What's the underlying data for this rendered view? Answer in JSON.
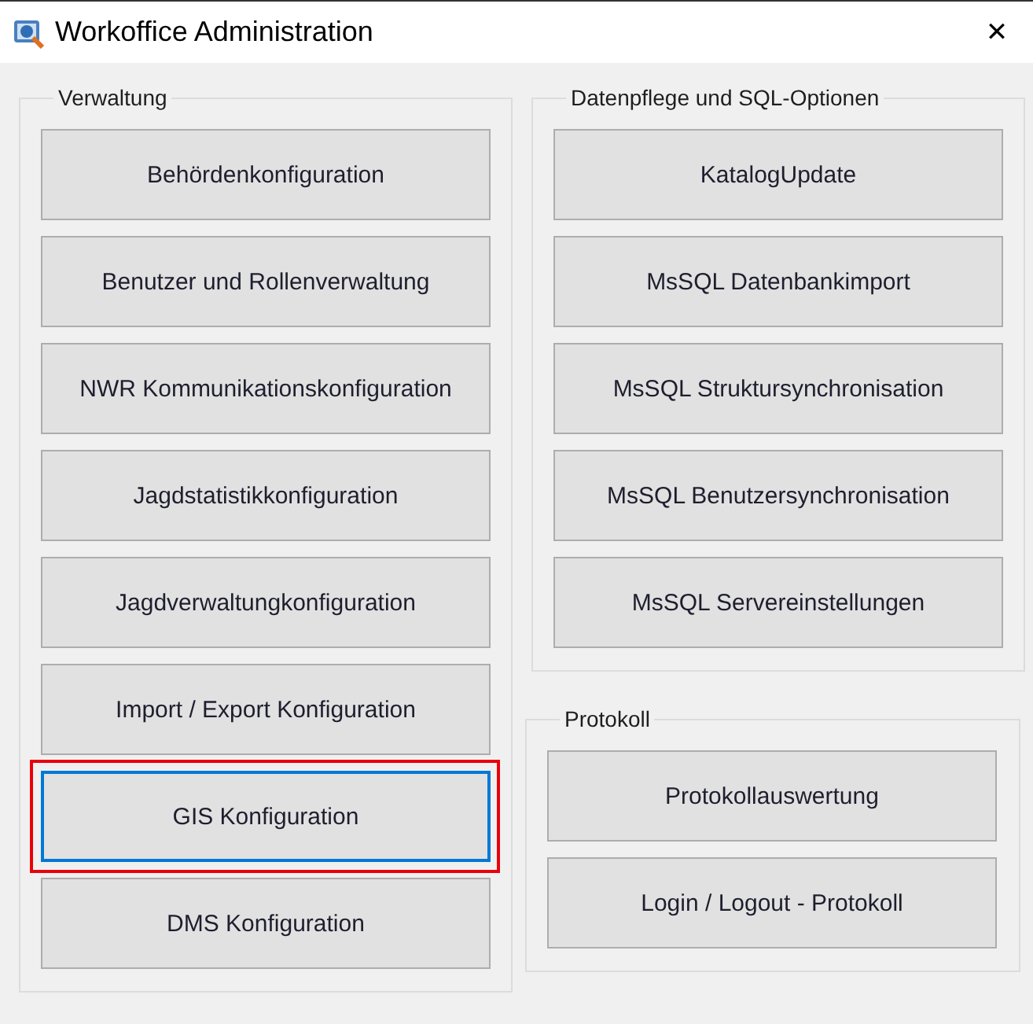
{
  "window": {
    "title": "Workoffice Administration",
    "close": "✕"
  },
  "groups": [
    {
      "title": "Verwaltung",
      "buttons": [
        {
          "label": "Behördenkonfiguration",
          "focused": false,
          "highlighted": false
        },
        {
          "label": "Benutzer und Rollenverwaltung",
          "focused": false,
          "highlighted": false
        },
        {
          "label": "NWR Kommunikationskonfiguration",
          "focused": false,
          "highlighted": false
        },
        {
          "label": "Jagdstatistikkonfiguration",
          "focused": false,
          "highlighted": false
        },
        {
          "label": "Jagdverwaltungkonfiguration",
          "focused": false,
          "highlighted": false
        },
        {
          "label": "Import / Export Konfiguration",
          "focused": false,
          "highlighted": false
        },
        {
          "label": "GIS Konfiguration",
          "focused": true,
          "highlighted": true
        },
        {
          "label": "DMS Konfiguration",
          "focused": false,
          "highlighted": false
        }
      ]
    },
    {
      "title": "Datenpflege und SQL-Optionen",
      "buttons": [
        {
          "label": "KatalogUpdate",
          "focused": false,
          "highlighted": false
        },
        {
          "label": "MsSQL Datenbankimport",
          "focused": false,
          "highlighted": false
        },
        {
          "label": "MsSQL Struktursynchronisation",
          "focused": false,
          "highlighted": false
        },
        {
          "label": "MsSQL Benutzersynchronisation",
          "focused": false,
          "highlighted": false
        },
        {
          "label": "MsSQL Servereinstellungen",
          "focused": false,
          "highlighted": false
        }
      ]
    },
    {
      "title": "Protokoll",
      "buttons": [
        {
          "label": "Protokollauswertung",
          "focused": false,
          "highlighted": false
        },
        {
          "label": "Login / Logout - Protokoll",
          "focused": false,
          "highlighted": false
        }
      ]
    }
  ]
}
